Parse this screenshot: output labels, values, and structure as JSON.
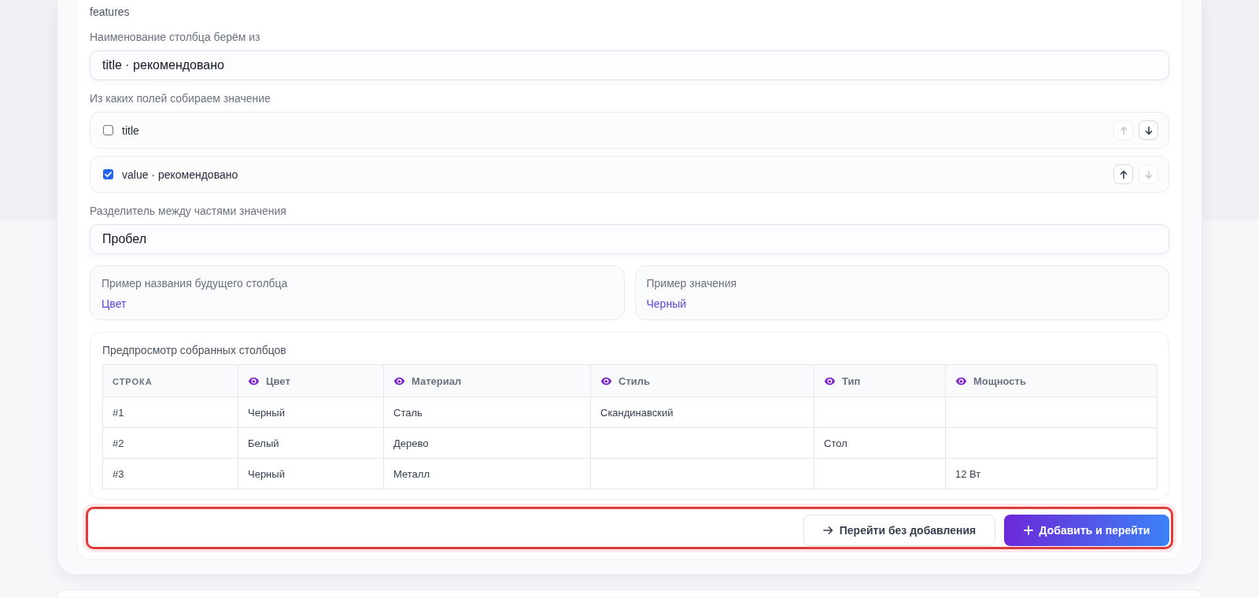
{
  "group_title": "features",
  "name_source": {
    "label": "Наименование столбца берём из",
    "value": "title · рекомендовано"
  },
  "value_fields": {
    "label": "Из каких полей собираем значение",
    "items": [
      {
        "name": "title",
        "checked": false,
        "up_disabled": true,
        "down_disabled": false
      },
      {
        "name": "value · рекомендовано",
        "checked": true,
        "up_disabled": false,
        "down_disabled": true
      }
    ]
  },
  "separator": {
    "label": "Разделитель между частями значения",
    "value": "Пробел"
  },
  "examples": [
    {
      "label": "Пример названия будущего столбца",
      "value": "Цвет"
    },
    {
      "label": "Пример значения",
      "value": "Черный"
    }
  ],
  "preview": {
    "title": "Предпросмотр собранных столбцов",
    "columns": [
      {
        "label": "СТРОКА",
        "kind": "row"
      },
      {
        "label": "Цвет",
        "kind": "field"
      },
      {
        "label": "Материал",
        "kind": "field"
      },
      {
        "label": "Стиль",
        "kind": "field"
      },
      {
        "label": "Тип",
        "kind": "field"
      },
      {
        "label": "Мощность",
        "kind": "field"
      }
    ],
    "rows": [
      [
        "#1",
        "Черный",
        "Сталь",
        "Скандинавский",
        null,
        null
      ],
      [
        "#2",
        "Белый",
        "Дерево",
        null,
        "Стол",
        null
      ],
      [
        "#3",
        "Черный",
        "Металл",
        null,
        null,
        "12 Вт"
      ]
    ]
  },
  "actions": {
    "highlighted": true,
    "buttons": [
      {
        "label": "Перейти без добавления",
        "kind": "secondary"
      },
      {
        "label": "Добавить и перейти",
        "kind": "primary"
      }
    ]
  }
}
